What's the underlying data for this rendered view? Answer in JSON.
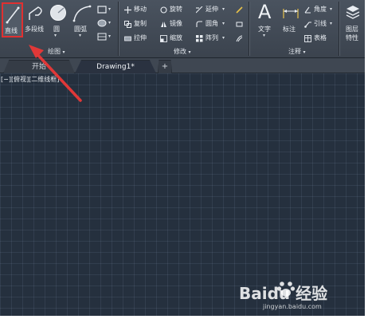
{
  "ribbon": {
    "draw_panel": {
      "title": "绘图",
      "line": "直线",
      "polyline": "多段线",
      "circle": "圆",
      "arc": "圆弧"
    },
    "modify_panel": {
      "title": "修改",
      "items": [
        "移动",
        "旋转",
        "延伸",
        "复制",
        "镜像",
        "圆角",
        "拉伸",
        "缩放",
        "阵列"
      ]
    },
    "annotate_panel": {
      "title": "注释",
      "text": "文字",
      "dimension": "标注",
      "angle": "角度",
      "leader": "引线",
      "table": "表格"
    },
    "layers": {
      "label_line1": "图层",
      "label_line2": "特性"
    }
  },
  "tabs": {
    "start": "开始",
    "drawing": "Drawing1*",
    "new": "+"
  },
  "viewport": {
    "label": "[−][俯视][二维线框]"
  },
  "watermark": {
    "brand": "Baidu 经验",
    "url": "jingyan.baidu.com"
  },
  "colors": {
    "highlight": "#e03030",
    "arrow": "#e03838",
    "canvas": "#25303e"
  }
}
